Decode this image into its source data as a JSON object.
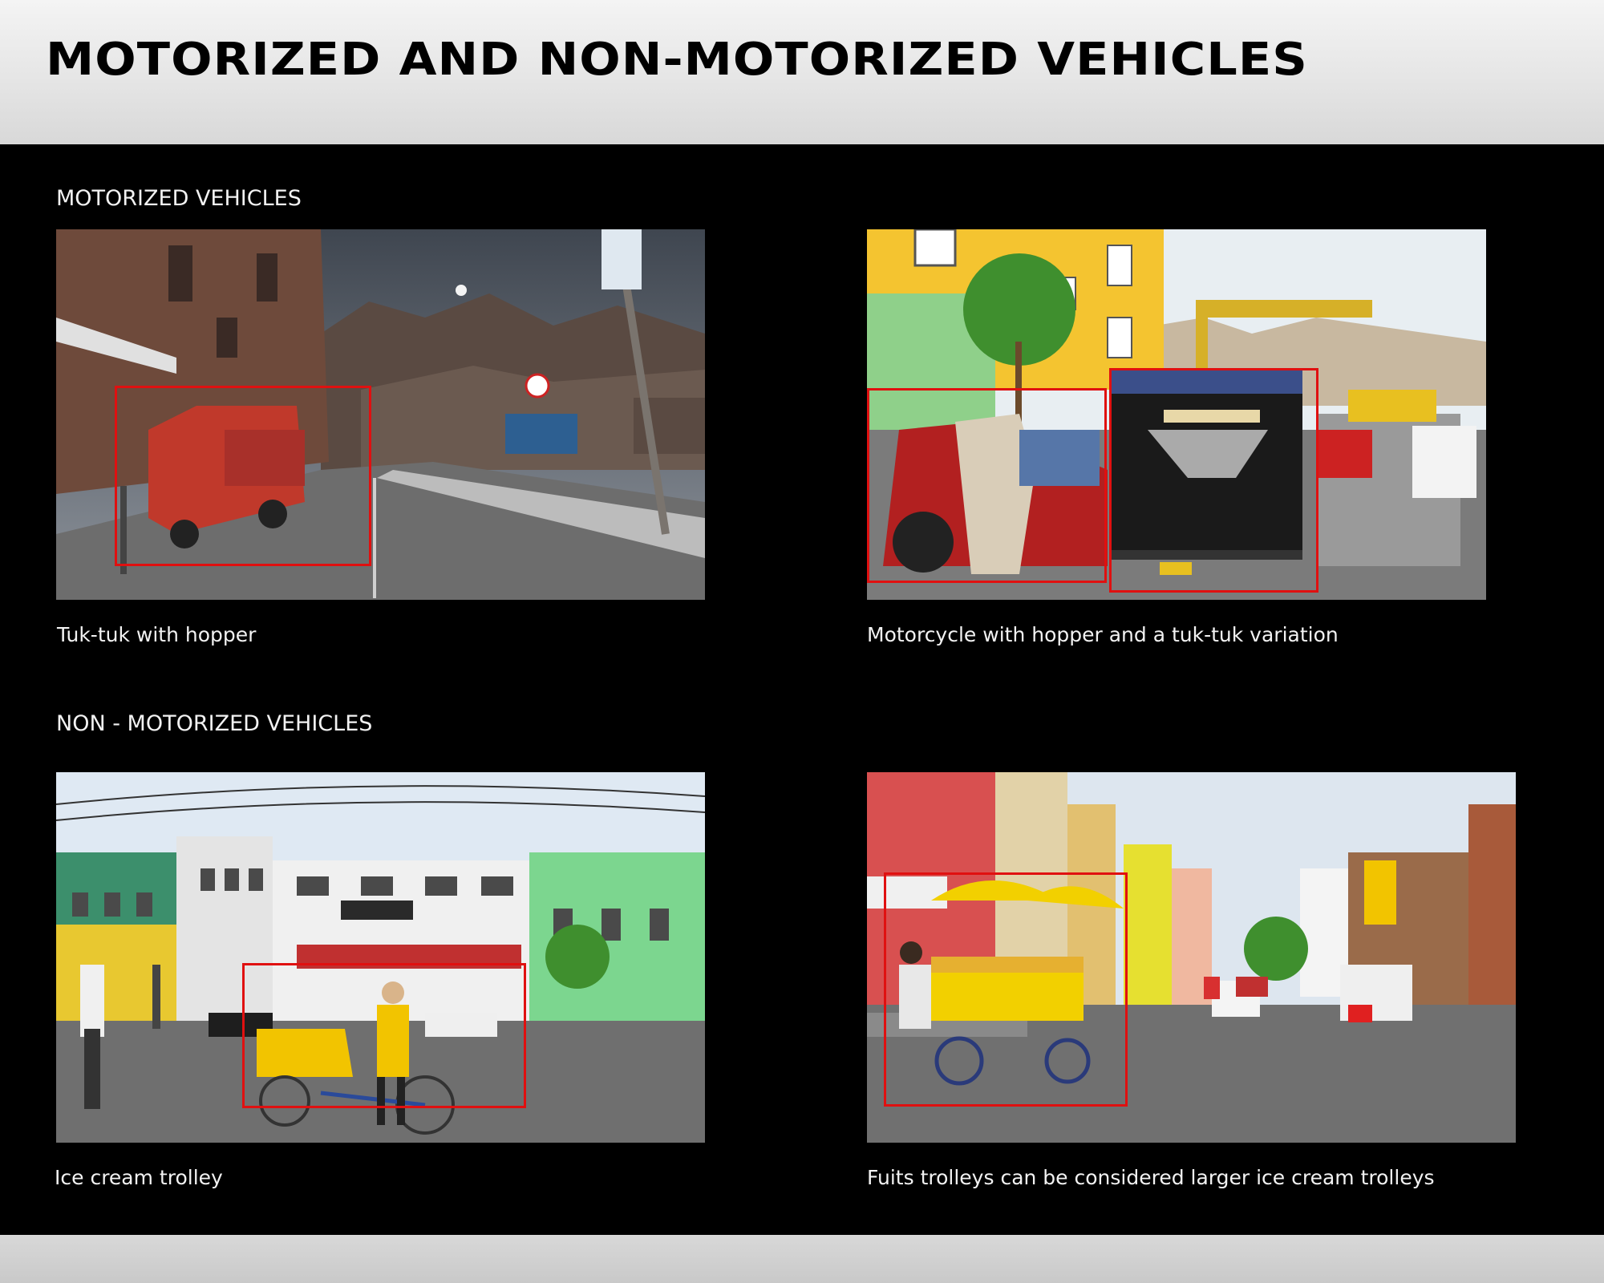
{
  "title": "MOTORIZED AND NON-MOTORIZED VEHICLES",
  "sections": [
    {
      "heading": "MOTORIZED VEHICLES",
      "photos": [
        {
          "caption": "Tuk-tuk with hopper"
        },
        {
          "caption": "Motorcycle with hopper and a tuk-tuk variation"
        }
      ]
    },
    {
      "heading": "NON - MOTORIZED VEHICLES",
      "photos": [
        {
          "caption": "Ice cream trolley"
        },
        {
          "caption": "Fuits trolleys can be considered larger ice cream trolleys"
        }
      ]
    }
  ],
  "colors": {
    "highlight_box": "#e01010",
    "slide_background": "#000000",
    "header_background": "#e8e8e8"
  }
}
